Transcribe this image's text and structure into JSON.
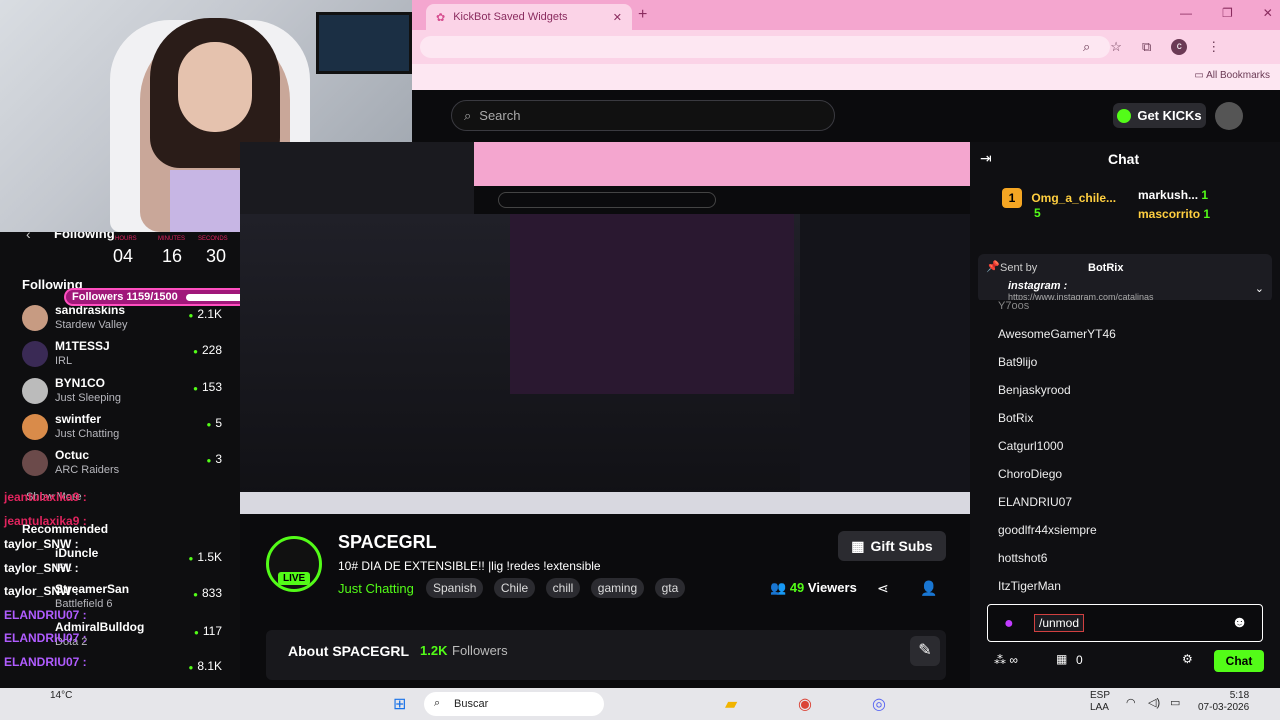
{
  "browser": {
    "tab_title": "KickBot Saved Widgets",
    "bookmarks_label": "All Bookmarks"
  },
  "kick": {
    "search_placeholder": "Search",
    "get_kicks_label": "Get KICKs",
    "chat_title": "Chat",
    "following_label": "Following",
    "following_section": "Following",
    "show_more": "Show More",
    "recommended_label": "Recommended"
  },
  "overlay": {
    "timer_labels": [
      "HOURS",
      "MINUTES",
      "SECONDS"
    ],
    "timer_values": [
      "04",
      "16",
      "30"
    ],
    "followers_goal": "Followers 1159/1500",
    "followers_progress": 0.77
  },
  "sidebar": {
    "following": [
      {
        "name": "sandraskins",
        "game": "Stardew Valley",
        "viewers": "2.1K"
      },
      {
        "name": "M1TESSJ",
        "game": "IRL",
        "viewers": "228"
      },
      {
        "name": "BYN1CO",
        "game": "Just Sleeping",
        "viewers": "153"
      },
      {
        "name": "swintfer",
        "game": "Just Chatting",
        "viewers": "5"
      },
      {
        "name": "Octuc",
        "game": "ARC Raiders",
        "viewers": "3"
      }
    ],
    "recommended": [
      {
        "name": "iDuncle",
        "game": "IRL",
        "viewers": "1.5K"
      },
      {
        "name": "StreamerSan",
        "game": "Battlefield 6",
        "viewers": "833"
      },
      {
        "name": "AdmiralBulldog",
        "game": "Dota 2",
        "viewers": "117"
      },
      {
        "name": "",
        "game": "",
        "viewers": "8.1K"
      }
    ]
  },
  "stream": {
    "channel": "SPACEGRL",
    "title": "10# DIA DE EXTENSIBLE!! |lig !redes !extensible",
    "category": "Just Chatting",
    "tags": [
      "Spanish",
      "Chile",
      "chill",
      "gaming",
      "gta"
    ],
    "viewers": "49",
    "viewers_label": "Viewers",
    "gift_subs_label": "Gift Subs",
    "live_badge": "LIVE",
    "about_label": "About SPACEGRL",
    "followers_count": "1.2K",
    "followers_label": "Followers"
  },
  "chat": {
    "top_gifters": [
      {
        "name": "Omg_a_chile...",
        "count": "5",
        "rank": "1"
      },
      {
        "name": "markush...",
        "count": "1"
      },
      {
        "name": "mascorrito",
        "count": "1"
      }
    ],
    "pinned_sent_by": "Sent by",
    "pinned_bot": "BotRix",
    "pinned_msg": "instagram :",
    "pinned_link": "https://www.instagram.com/catalinas",
    "user_list": [
      "AwesomeGamerYT46",
      "Bat9lijo",
      "Benjaskyrood",
      "BotRix",
      "Catgurl1000",
      "ChoroDiego",
      "ELANDRIU07",
      "goodlfr44xsiempre",
      "hottshot6",
      "ItzTigerMan"
    ],
    "partial_top": "Y7oos",
    "input_value": "/unmod",
    "kicks_count": "0",
    "send_label": "Chat"
  },
  "chat_overlay": {
    "lines": [
      "jeantulaxika9 :",
      "jeantulaxika9 :",
      "taylor_SNW :",
      "taylor_SNW :",
      "taylor_SNW :",
      "ELANDRIU07 :",
      "ELANDRIU07 :",
      "ELANDRIU07 :",
      "ELANDRIU07 :",
      "ELANDRIU07 :"
    ]
  },
  "taskbar": {
    "search_label": "Buscar",
    "language": "ESP",
    "region": "LAA",
    "time": "5:18",
    "date": "07-03-2026",
    "weather": "14°C"
  }
}
